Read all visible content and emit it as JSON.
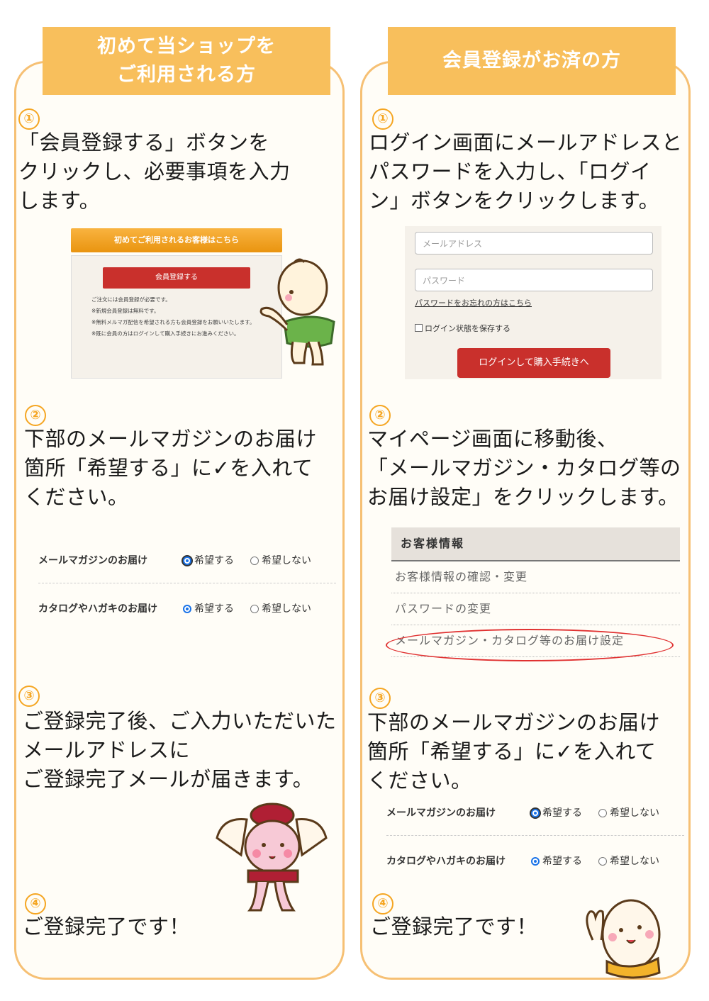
{
  "colors": {
    "accent": "#f8bf5c",
    "border": "#f6c074",
    "red_button": "#c9302c",
    "circle": "#e03030"
  },
  "left": {
    "banner": "初めて当ショップを\nご利用される方",
    "steps": [
      {
        "num": "①",
        "text": "「会員登録する」ボタンを\nクリックし、必要事項を入力\nします。"
      },
      {
        "num": "②",
        "text": "下部のメールマガジンのお届け\n箇所「希望する」に✓を入れて\nください。"
      },
      {
        "num": "③",
        "text": "ご登録完了後、ご入力いただいた\nメールアドレスに\nご登録完了メールが届きます。"
      },
      {
        "num": "④",
        "text": "ご登録完了です！"
      }
    ],
    "register_shot": {
      "header": "初めてご利用されるお客様はこちら",
      "button": "会員登録する",
      "notes": [
        "ご注文には会員登録が必要です。",
        "※新規会員登録は無料です。",
        "※無料メルマガ配信を希望される方も会員登録をお願いいたします。",
        "※既に会員の方はログインして購入手続きにお進みください。"
      ]
    }
  },
  "right": {
    "banner": "会員登録がお済の方",
    "steps": [
      {
        "num": "①",
        "text": "ログイン画面にメールアドレスと\nパスワードを入力し、「ログイ\nン」ボタンをクリックします。"
      },
      {
        "num": "②",
        "text": "マイページ画面に移動後、\n「メールマガジン・カタログ等の\nお届け設定」をクリックします。"
      },
      {
        "num": "③",
        "text": "下部のメールマガジンのお届け\n箇所「希望する」に✓を入れて\nください。"
      },
      {
        "num": "④",
        "text": "ご登録完了です！"
      }
    ],
    "login_shot": {
      "email_placeholder": "メールアドレス",
      "password_placeholder": "パスワード",
      "forgot_link": "パスワードをお忘れの方はこちら",
      "remember": "ログイン状態を保存する",
      "button": "ログインして購入手続きへ"
    },
    "mypage_menu": {
      "header": "お客様情報",
      "items": [
        "お客様情報の確認・変更",
        "パスワードの変更",
        "メールマガジン・カタログ等のお届け設定"
      ]
    }
  },
  "newsletter_form": {
    "rows": [
      {
        "label": "メールマガジンのお届け",
        "yes": "希望する",
        "no": "希望しない"
      },
      {
        "label": "カタログやハガキのお届け",
        "yes": "希望する",
        "no": "希望しない"
      }
    ]
  }
}
